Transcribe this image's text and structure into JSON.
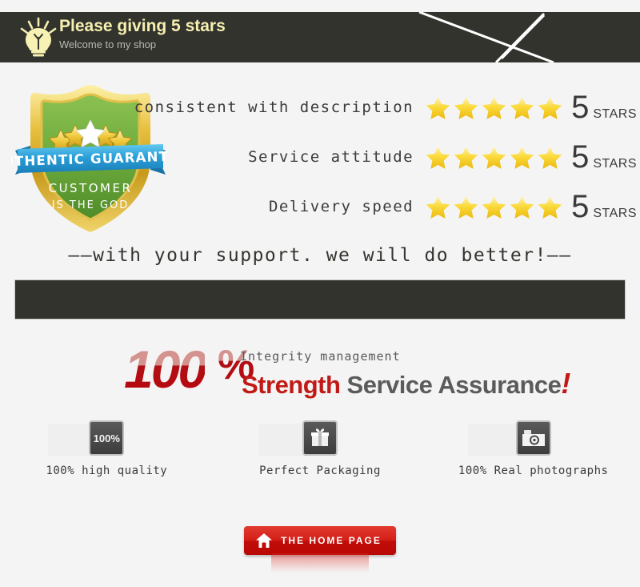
{
  "theme": {
    "page_bg": "#f4f4f4",
    "dark_bar": "#33332e",
    "header_title_color": "#f5f0b0",
    "header_sub_color": "#b9b9b4",
    "accent_red": "#c11a16",
    "star_gold": "#f5c518",
    "text_dark": "#3b3b3b"
  },
  "header": {
    "icon": "lightbulb-icon",
    "title": "Please giving 5 stars",
    "subtitle": "Welcome to my shop",
    "decoration": "envelope-lines"
  },
  "badge": {
    "icon": "authentic-guarantee-shield",
    "banner_text": "AUTHENTIC  GUARANTEE",
    "line1": "CUSTOMER",
    "line2": "IS THE GOD",
    "stars": 5
  },
  "ratings": [
    {
      "label": "consistent with description",
      "stars": 5,
      "score": "5",
      "unit": "STARS"
    },
    {
      "label": "Service attitude",
      "stars": 5,
      "score": "5",
      "unit": "STARS"
    },
    {
      "label": "Delivery speed",
      "stars": 5,
      "score": "5",
      "unit": "STARS"
    }
  ],
  "support_line": "——with your support. we will do better!——",
  "divider_bar": {
    "label": ""
  },
  "headline": {
    "percent": "100",
    "percent_symbol": "%",
    "tagline": "Integrity management",
    "strength": "Strength",
    "assurance": " Service Assurance",
    "exclaim": "!"
  },
  "features": [
    {
      "icon": "hundred-percent-badge-icon",
      "icon_text": "100%",
      "label": "100% high quality"
    },
    {
      "icon": "gift-box-icon",
      "icon_text": "",
      "label": "Perfect Packaging"
    },
    {
      "icon": "camera-icon",
      "icon_text": "",
      "label": "100% Real photographs"
    }
  ],
  "home_button": {
    "icon": "home-icon",
    "label": "THE HOME PAGE"
  }
}
